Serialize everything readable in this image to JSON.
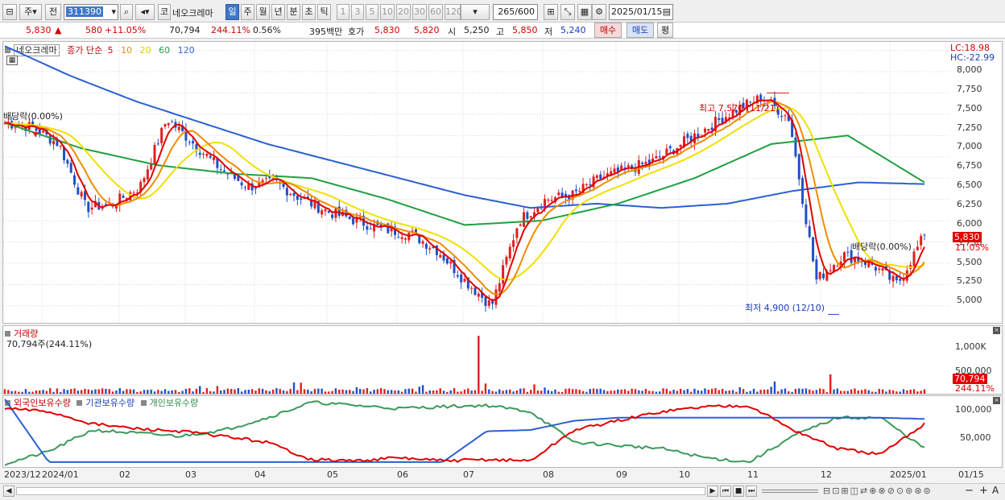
{
  "toolbar": {
    "market": "주",
    "prev": "전",
    "code": "311390",
    "code_type": "코",
    "stock_name": "네오크레마",
    "periods": [
      "일",
      "주",
      "월",
      "년",
      "분",
      "초",
      "틱"
    ],
    "minutes": [
      "1",
      "3",
      "5",
      "10",
      "20",
      "30",
      "60",
      "120"
    ],
    "count": "265",
    "count_total": "/600",
    "date": "2025/01/15"
  },
  "quote": {
    "price": "5,830",
    "change_arrow": "▲",
    "change": "580",
    "change_pct": "+11.05%",
    "volume": "70,794",
    "volume_pct": "244.11%",
    "turnover": "0.56%",
    "amount": "395백만",
    "ask_label": "호가",
    "ask": "5,830",
    "bid": "5,820",
    "open_label": "시",
    "open": "5,250",
    "high_label": "고",
    "high": "5,850",
    "low_label": "저",
    "low": "5,240",
    "buy_label": "매수",
    "sell_label": "매도",
    "avg_label": "평"
  },
  "price_pane": {
    "name_label": "네오크레마",
    "indicator_label": "종가 단순",
    "ma_periods": [
      "5",
      "10",
      "20",
      "60",
      "120"
    ],
    "lc": "LC:18.98",
    "hc": "HC:-22.99",
    "current_tag": "5,830",
    "current_pct_tag": "11.05%",
    "dividend_label_1": "배당락(0.00%)",
    "dividend_label_2": "배당락(0.00%)",
    "high_annotation": "최고 7,570 (11/21)",
    "low_annotation": "최저 4,900 (12/10)",
    "y_ticks": [
      "8,000",
      "7,750",
      "7,500",
      "7,250",
      "7,000",
      "6,750",
      "6,500",
      "6,250",
      "6,000",
      "5,750",
      "5,500",
      "5,250",
      "5,000"
    ]
  },
  "volume_pane": {
    "title": "거래량",
    "value": "70,794주(244.11%)",
    "y_ticks": [
      "1,000K",
      "500,000"
    ],
    "current_tag": "70,794",
    "current_pct_tag": "244.11%"
  },
  "holding_pane": {
    "series": [
      "외국인보유수량",
      "기관보유수량",
      "개인보유수량"
    ],
    "y_ticks": [
      "100,000",
      "50,000"
    ]
  },
  "x_axis": [
    "2023/12",
    "2024/01",
    "02",
    "03",
    "04",
    "05",
    "06",
    "07",
    "08",
    "09",
    "10",
    "11",
    "12",
    "2025/01",
    "01/15"
  ],
  "colors": {
    "up": "#e02020",
    "down": "#2050c8",
    "ma5": "#e00000",
    "ma10": "#f08c00",
    "ma20": "#f0e000",
    "ma60": "#20a040",
    "ma120": "#2a60d0",
    "foreign": "#e00000",
    "inst": "#2a60d0",
    "retail": "#3a9a5a"
  },
  "chart_data": {
    "type": "line",
    "title": "",
    "price_range": [
      4900,
      8000
    ],
    "high": {
      "value": 7570,
      "date": "11/21"
    },
    "low": {
      "value": 4900,
      "date": "12/10"
    },
    "close_series_approx": [
      7150,
      7100,
      6900,
      6150,
      6200,
      6400,
      7200,
      6900,
      6600,
      6400,
      6450,
      6250,
      6100,
      6000,
      5900,
      5850,
      5650,
      5300,
      5000,
      6000,
      6250,
      6300,
      6500,
      6600,
      6700,
      6900,
      7100,
      7300,
      7450,
      7200,
      5300,
      5600,
      5500,
      5250,
      5830
    ],
    "ma120_approx": [
      8050,
      7700,
      7400,
      7150,
      6900,
      6700,
      6500,
      6300,
      6150,
      6200,
      6150,
      6200,
      6350,
      6450,
      6430
    ],
    "ma60_approx": [
      7150,
      6850,
      6650,
      6550,
      6500,
      6250,
      5950,
      6000,
      6200,
      6500,
      6900,
      7000,
      6450
    ]
  }
}
